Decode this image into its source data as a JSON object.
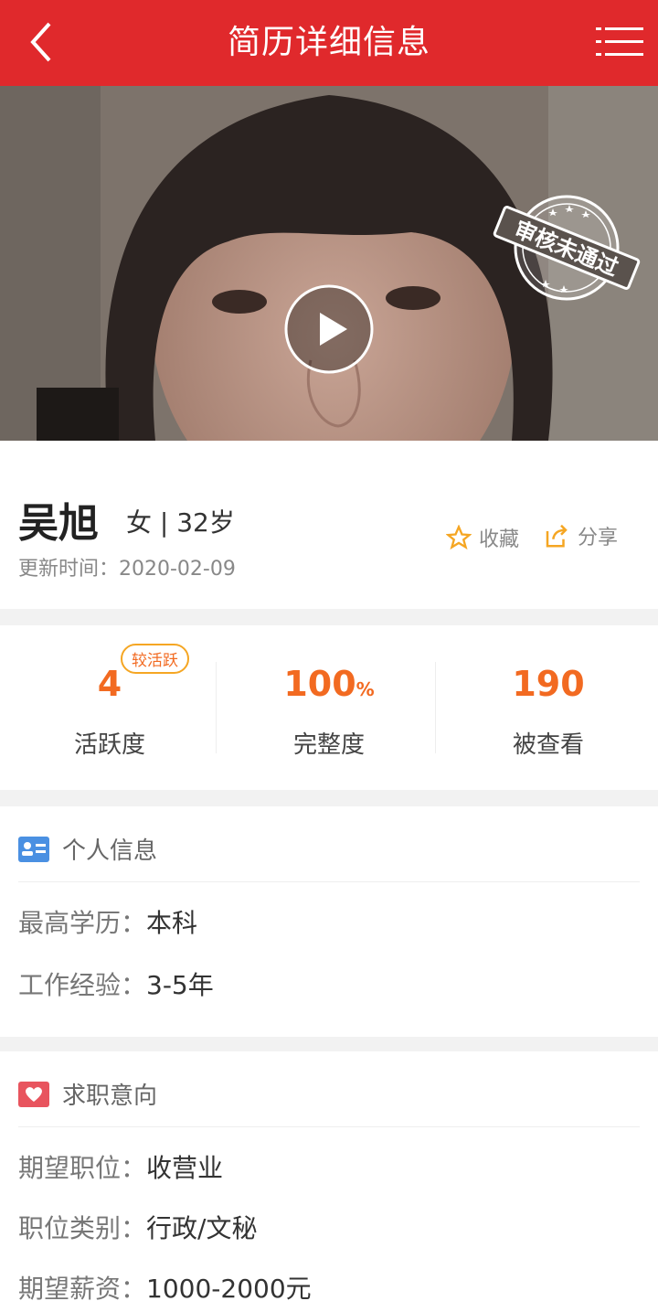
{
  "header": {
    "title": "简历详细信息"
  },
  "video": {
    "stamp_text": "审核未通过"
  },
  "profile": {
    "name": "吴旭",
    "gender_age": "女 | 32岁",
    "update_time": "更新时间：2020-02-09",
    "favorite_label": "收藏",
    "share_label": "分享"
  },
  "stats": {
    "activity_value": "4",
    "activity_label": "活跃度",
    "activity_badge": "较活跃",
    "completeness_value": "100",
    "completeness_unit": "%",
    "completeness_label": "完整度",
    "views_value": "190",
    "views_label": "被查看"
  },
  "personal": {
    "title": "个人信息",
    "education_key": "最高学历：",
    "education_value": "本科",
    "experience_key": "工作经验：",
    "experience_value": "3-5年"
  },
  "intent": {
    "title": "求职意向",
    "position_key": "期望职位：",
    "position_value": "收营业",
    "category_key": "职位类别：",
    "category_value": "行政/文秘",
    "salary_key": "期望薪资：",
    "salary_value": "1000-2000元"
  },
  "colors": {
    "brand": "#e0292c",
    "accent": "#f26a21"
  }
}
